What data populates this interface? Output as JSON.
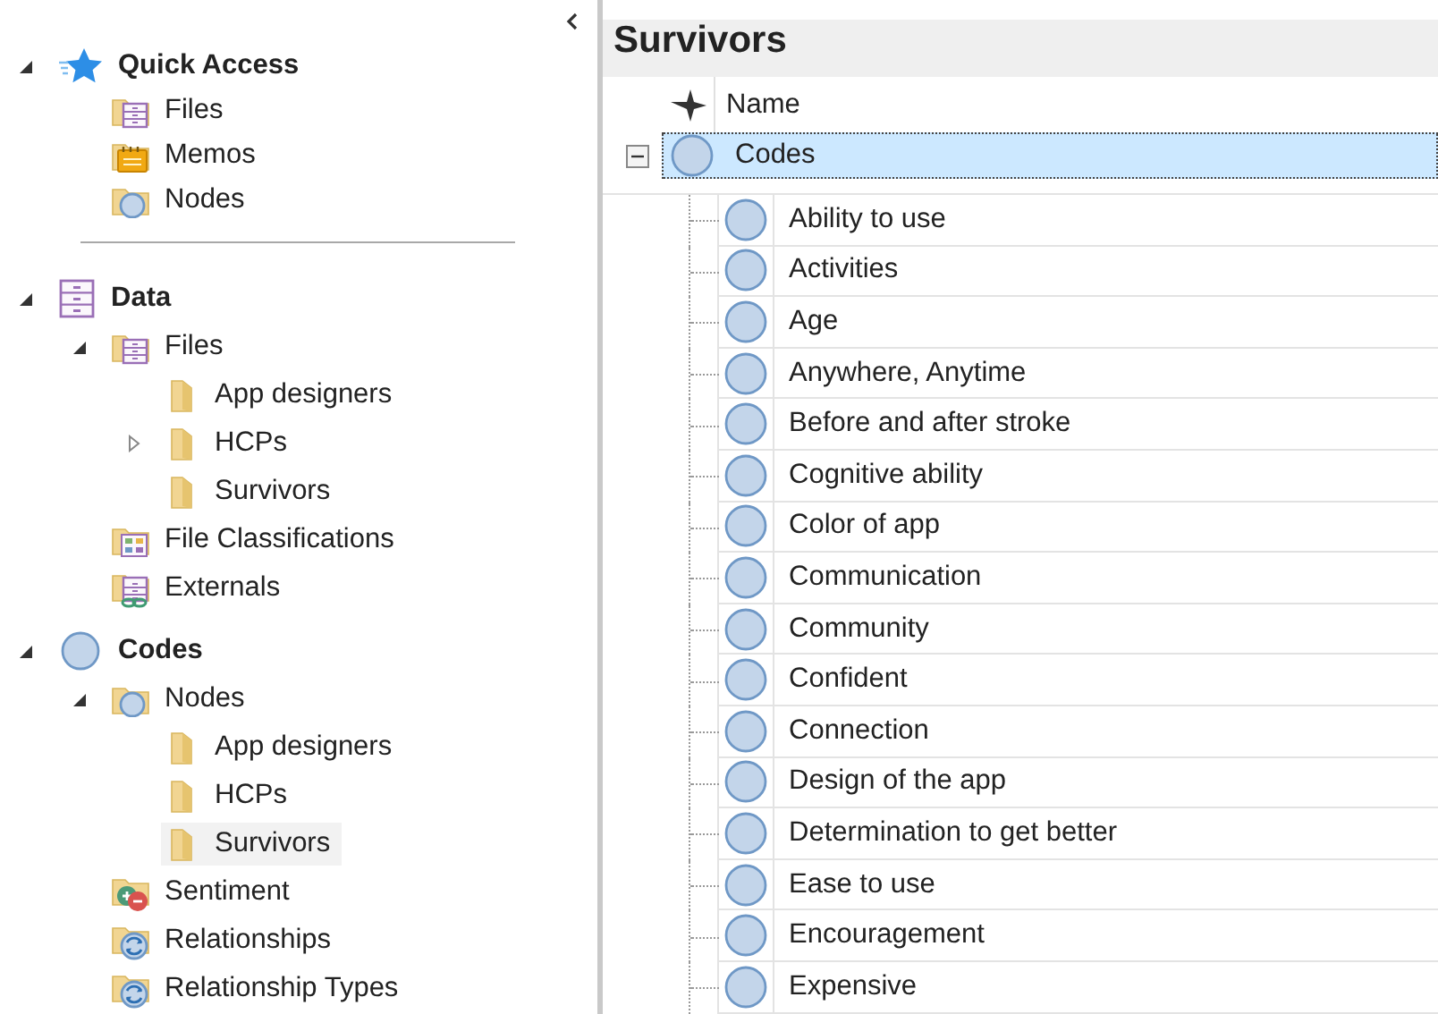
{
  "nav_pane": {
    "quick_access": {
      "label": "Quick Access",
      "expanded": true,
      "items": [
        {
          "label": "Files",
          "kind": "files",
          "selected": false
        },
        {
          "label": "Memos",
          "kind": "memos",
          "selected": false
        },
        {
          "label": "Nodes",
          "kind": "nodes",
          "selected": false
        }
      ]
    },
    "tree": [
      {
        "label": "Data",
        "kind": "cabinet",
        "expanded": true,
        "selected": false,
        "children": [
          {
            "label": "Files",
            "kind": "files",
            "expanded": true,
            "selected": false,
            "children": [
              {
                "label": "App designers",
                "kind": "folder",
                "selected": false
              },
              {
                "label": "HCPs",
                "kind": "folder",
                "expanded": false,
                "selected": false
              },
              {
                "label": "Survivors",
                "kind": "folder",
                "selected": false
              }
            ]
          },
          {
            "label": "File Classifications",
            "kind": "classifications",
            "selected": false
          },
          {
            "label": "Externals",
            "kind": "externals",
            "selected": false
          }
        ]
      },
      {
        "label": "Codes",
        "kind": "circle",
        "expanded": true,
        "selected": false,
        "children": [
          {
            "label": "Nodes",
            "kind": "nodes",
            "expanded": true,
            "selected": false,
            "children": [
              {
                "label": "App designers",
                "kind": "folder",
                "selected": false
              },
              {
                "label": "HCPs",
                "kind": "folder",
                "selected": false
              },
              {
                "label": "Survivors",
                "kind": "folder",
                "selected": true
              }
            ]
          },
          {
            "label": "Sentiment",
            "kind": "sentiment",
            "selected": false
          },
          {
            "label": "Relationships",
            "kind": "relationships",
            "selected": false
          },
          {
            "label": "Relationship Types",
            "kind": "relationships",
            "selected": false
          }
        ]
      }
    ]
  },
  "detail": {
    "title": "Survivors",
    "columns": [
      "Name"
    ],
    "root": {
      "label": "Codes",
      "expanded": true,
      "selected": true,
      "children": [
        {
          "label": "Ability to use",
          "selected": false
        },
        {
          "label": "Activities",
          "selected": false
        },
        {
          "label": "Age",
          "selected": false
        },
        {
          "label": "Anywhere, Anytime",
          "selected": false
        },
        {
          "label": "Before and after stroke",
          "selected": false
        },
        {
          "label": "Cognitive ability",
          "selected": false
        },
        {
          "label": "Color of app",
          "selected": false
        },
        {
          "label": "Communication",
          "selected": false
        },
        {
          "label": "Community",
          "selected": false
        },
        {
          "label": "Confident",
          "selected": false
        },
        {
          "label": "Connection",
          "selected": false
        },
        {
          "label": "Design of the app",
          "selected": false
        },
        {
          "label": "Determination to get better",
          "selected": false
        },
        {
          "label": "Ease to use",
          "selected": false
        },
        {
          "label": "Encouragement",
          "selected": false
        },
        {
          "label": "Expensive",
          "selected": false
        }
      ]
    }
  }
}
